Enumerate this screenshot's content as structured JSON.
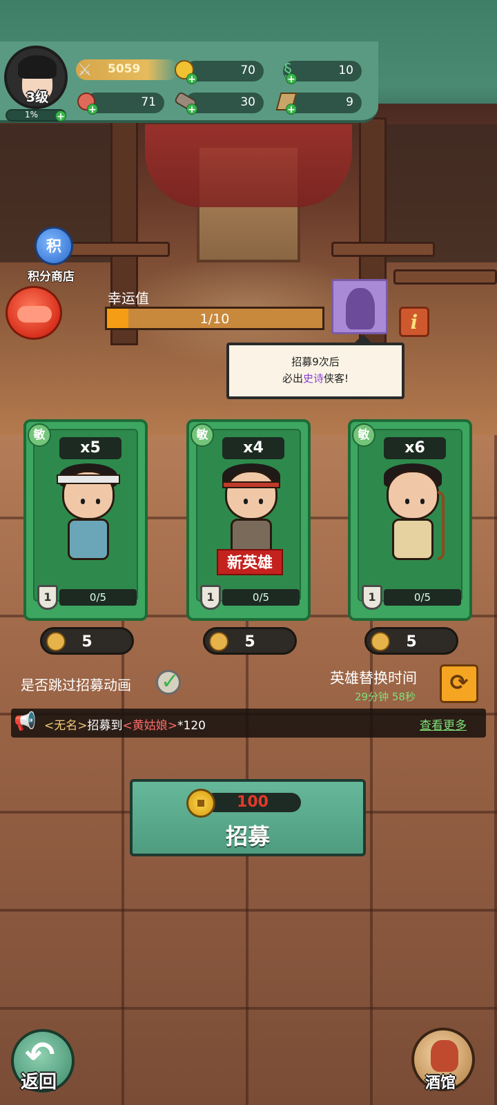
{
  "player": {
    "level_label": "3级",
    "exp_label": "1%",
    "exp_fraction": 0.01
  },
  "resources": {
    "power": "5059",
    "coins": "70",
    "jade": "10",
    "meat": "71",
    "wood": "30",
    "scroll": "9"
  },
  "side": {
    "shop_glyph": "积",
    "shop_label": "积分商店"
  },
  "luck": {
    "label": "幸运值",
    "value_text": "1/10",
    "fraction": 0.1,
    "info_glyph": "i"
  },
  "tooltip": {
    "line1": "招募9次后",
    "line2_prefix": "必出",
    "line2_highlight": "史诗",
    "line2_suffix": "侠客!",
    "highlight_color": "#8a3fd0"
  },
  "cards": [
    {
      "type": "敏",
      "count": "x5",
      "level": "1",
      "fragments": "0/5",
      "cost": "5",
      "is_new": false,
      "new_label": ""
    },
    {
      "type": "敏",
      "count": "x4",
      "level": "1",
      "fragments": "0/5",
      "cost": "5",
      "is_new": true,
      "new_label": "新英雄"
    },
    {
      "type": "敏",
      "count": "x6",
      "level": "1",
      "fragments": "0/5",
      "cost": "5",
      "is_new": false,
      "new_label": ""
    }
  ],
  "skip": {
    "label": "是否跳过招募动画",
    "checked": true,
    "check_glyph": "✓"
  },
  "timer": {
    "label": "英雄替换时间",
    "value": "29分钟  58秒",
    "refresh_glyph": "⟳"
  },
  "broadcast": {
    "lb1": "<",
    "player": "无名",
    "rb1": ">",
    "action": "招募到",
    "lb2": "<",
    "hero": "黄姑娘",
    "rb2": ">",
    "amount": "*120",
    "more_link": "查看更多"
  },
  "recruit": {
    "cost": "100",
    "label": "招募"
  },
  "bottom": {
    "back_label": "返回",
    "tavern_label": "酒馆"
  }
}
